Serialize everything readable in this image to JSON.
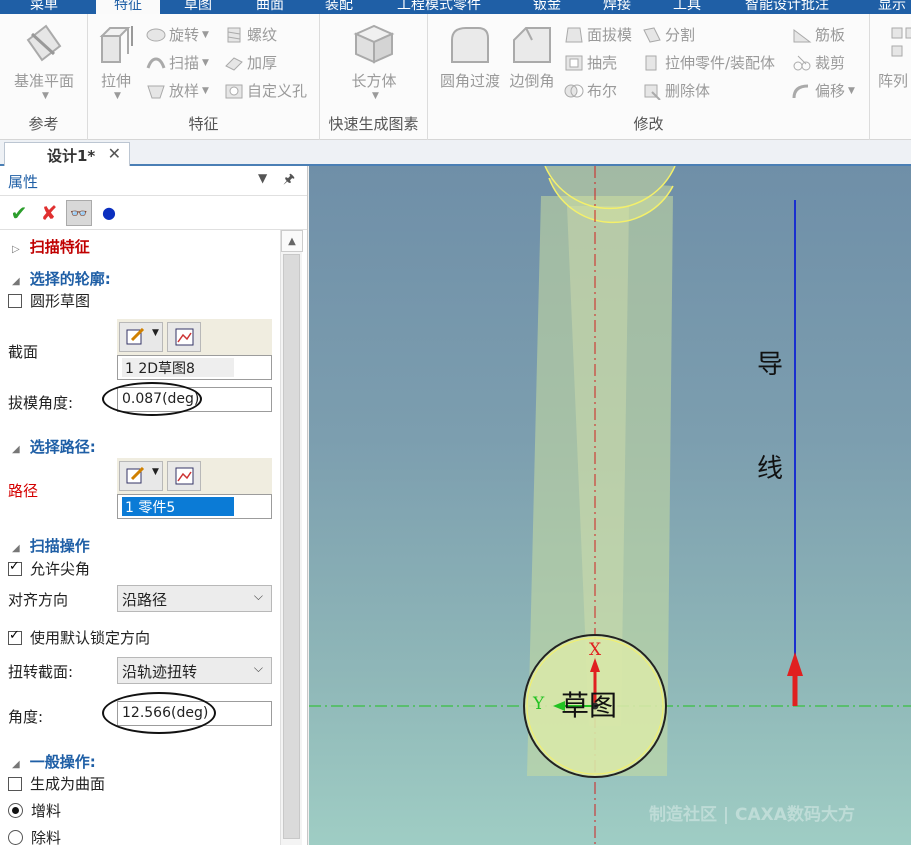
{
  "ribbon_tabs": [
    "菜单",
    "特征",
    "草图",
    "曲面",
    "装配",
    "工程模式零件",
    "钣金",
    "焊接",
    "工具",
    "智能设计批注",
    "显示"
  ],
  "ribbon": {
    "groups": {
      "ref": "参考",
      "feature": "特征",
      "quick": "快速生成图素",
      "modify": "修改"
    },
    "buttons": {
      "datum_plane": "基准平面",
      "extrude": "拉伸",
      "revolve": "旋转",
      "sweep": "扫描",
      "loft": "放样",
      "thread": "螺纹",
      "thicken": "加厚",
      "custom_hole": "自定义孔",
      "box": "长方体",
      "fillet": "圆角过渡",
      "chamfer": "边倒角",
      "face_draft": "面拔模",
      "shell": "抽壳",
      "boolean": "布尔",
      "split": "分割",
      "extrude_part": "拉伸零件/装配体",
      "delete_body": "删除体",
      "rib": "筋板",
      "trim": "裁剪",
      "offset": "偏移",
      "array": "阵列"
    }
  },
  "doc_tab": {
    "label": "设计1*"
  },
  "panel": {
    "title": "属性",
    "feature_title": "扫描特征",
    "section_profile": "选择的轮廓:",
    "circle_sketch": "圆形草图",
    "section_label": "截面",
    "section_item": "1   2D草图8",
    "draft_angle_label": "拔模角度:",
    "draft_angle_value": "0.087(deg)",
    "section_path": "选择路径:",
    "path_label": "路径",
    "path_item": "1   零件5",
    "section_sweep_ops": "扫描操作",
    "allow_sharp": "允许尖角",
    "align_label": "对齐方向",
    "align_value": "沿路径",
    "use_default_lock": "使用默认锁定方向",
    "twist_label": "扭转截面:",
    "twist_value": "沿轨迹扭转",
    "angle_label": "角度:",
    "angle_value": "12.566(deg)",
    "section_general": "一般操作:",
    "gen_surface": "生成为曲面",
    "add_material": "增料",
    "remove_material": "除料"
  },
  "viewport": {
    "guide_char_1": "导",
    "guide_char_2": "线",
    "sketch_label": "草图",
    "axis_x": "X",
    "axis_y": "Y",
    "watermark": "制造社区 | CAXA数码大方"
  },
  "colors": {
    "accent": "#1f5fa6",
    "check_green": "#2c9e2c",
    "cancel_red": "#e03030",
    "path_selected": "#0b7bd6",
    "guide_line": "#1a2fcf"
  }
}
